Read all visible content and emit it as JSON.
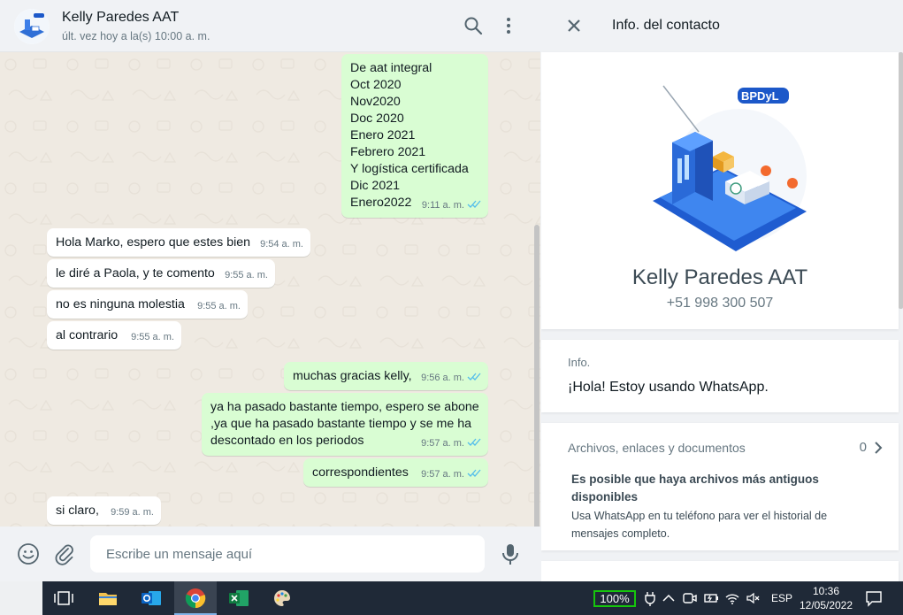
{
  "chat": {
    "contact_name": "Kelly Paredes AAT",
    "last_seen": "últ. vez hoy a la(s) 10:00 a. m.",
    "header_icons": [
      "search-icon",
      "menu-icon"
    ],
    "messages": [
      {
        "direction": "out",
        "text": "De aat integral\nOct 2020\nNov2020\nDoc 2020\nEnero 2021\nFebrero 2021\nY logística certificada\nDic 2021\nEnero2022",
        "time": "9:11 a. m.",
        "read": true
      },
      {
        "direction": "in",
        "text": "Hola Marko, espero que estes bien",
        "time": "9:54 a. m."
      },
      {
        "direction": "in",
        "text": "le diré a Paola, y te comento",
        "time": "9:55 a. m."
      },
      {
        "direction": "in",
        "text": "no es ninguna molestia",
        "time": "9:55 a. m."
      },
      {
        "direction": "in",
        "text": "al contrario",
        "time": "9:55 a. m."
      },
      {
        "direction": "out",
        "text": "muchas gracias kelly,",
        "time": "9:56 a. m.",
        "read": true
      },
      {
        "direction": "out",
        "text": "ya ha pasado bastante tiempo, espero se abone\n,ya que ha pasado bastante tiempo y se me ha\ndescontado en los periodos",
        "time": "9:57 a. m.",
        "read": true
      },
      {
        "direction": "out",
        "text": "correspondientes",
        "time": "9:57 a. m.",
        "read": true
      },
      {
        "direction": "in",
        "text": "si claro,",
        "time": "9:59 a. m."
      }
    ],
    "composer": {
      "placeholder": "Escribe un mensaje aquí",
      "icons": [
        "emoji-icon",
        "attach-icon",
        "microphone-icon"
      ]
    }
  },
  "contact_info": {
    "title": "Info. del contacto",
    "name": "Kelly Paredes AAT",
    "phone": "+51 998 300 507",
    "avatar_logo_text": "BPDyL",
    "about_label": "Info.",
    "about_text": "¡Hola! Estoy usando WhatsApp.",
    "files_label": "Archivos, enlaces y documentos",
    "files_count": "0",
    "files_note_title": "Es posible que haya archivos más antiguos disponibles",
    "files_note_body": "Usa WhatsApp en tu teléfono para ver el historial de mensajes completo."
  },
  "taskbar": {
    "apps": [
      "task-view-icon",
      "file-explorer-icon",
      "outlook-icon",
      "chrome-icon",
      "excel-icon",
      "paint-icon"
    ],
    "active_app": "chrome-icon",
    "battery_percent": "100%",
    "language": "ESP",
    "time": "10:36",
    "date": "12/05/2022"
  },
  "colors": {
    "outgoing_bubble": "#d9fdd3",
    "incoming_bubble": "#ffffff",
    "chat_background": "#efeae2",
    "read_ticks": "#53bdeb",
    "taskbar": "#1f2937"
  }
}
